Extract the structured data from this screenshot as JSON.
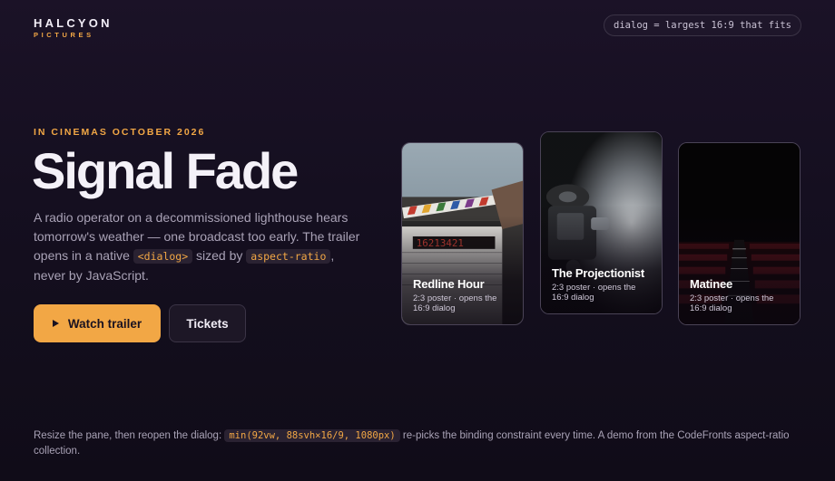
{
  "brand": {
    "name": "HALCYON",
    "sub": "PICTURES"
  },
  "badge": {
    "text": "dialog = largest 16:9 that fits"
  },
  "hero": {
    "eyebrow": "IN CINEMAS OCTOBER 2026",
    "title": "Signal Fade",
    "desc_1": "A radio operator on a decommissioned lighthouse hears tomorrow's weather — one broadcast too early. The trailer opens in a native ",
    "desc_code_1": "<dialog>",
    "desc_2": " sized by ",
    "desc_code_2": "aspect-ratio",
    "desc_3": ", never by JavaScript.",
    "watch_label": "Watch trailer",
    "tickets_label": "Tickets"
  },
  "posters": [
    {
      "title": "Redline Hour",
      "subtitle": "2:3 poster · opens the 16:9 dialog"
    },
    {
      "title": "The Projectionist",
      "subtitle": "2:3 poster · opens the 16:9 dialog"
    },
    {
      "title": "Matinee",
      "subtitle": "2:3 poster · opens the 16:9 dialog"
    }
  ],
  "footer": {
    "text_1": "Resize the pane, then reopen the dialog: ",
    "code": "min(92vw, 88svh×16/9, 1080px)",
    "text_2": " re-picks the binding constraint every time. A demo from the CodeFronts aspect-ratio collection."
  },
  "colors": {
    "accent": "#f2a745",
    "background": "#150f20"
  }
}
